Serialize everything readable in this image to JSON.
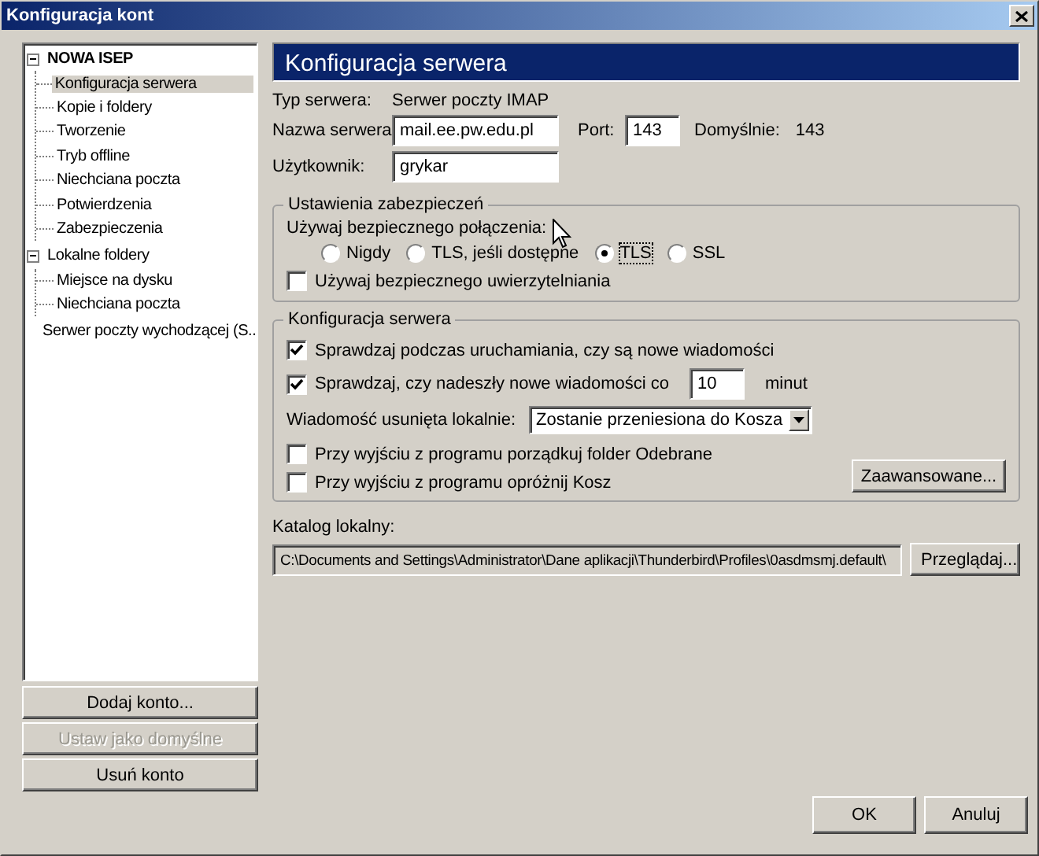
{
  "window": {
    "title": "Konfiguracja kont"
  },
  "tree": [
    {
      "label": "NOWA ISEP",
      "expanded": true,
      "selected": false,
      "children": [
        {
          "label": "Konfiguracja serwera",
          "selected": true
        },
        {
          "label": "Kopie i foldery",
          "selected": false
        },
        {
          "label": "Tworzenie",
          "selected": false
        },
        {
          "label": "Tryb offline",
          "selected": false
        },
        {
          "label": "Niechciana poczta",
          "selected": false
        },
        {
          "label": "Potwierdzenia",
          "selected": false
        },
        {
          "label": "Zabezpieczenia",
          "selected": false
        }
      ]
    },
    {
      "label": "Lokalne foldery",
      "expanded": true,
      "selected": false,
      "children": [
        {
          "label": "Miejsce na dysku",
          "selected": false
        },
        {
          "label": "Niechciana poczta",
          "selected": false
        }
      ]
    },
    {
      "label": "Serwer poczty wychodzącej (S...",
      "selected": false
    }
  ],
  "account_buttons": [
    {
      "label": "Dodaj konto...",
      "disabled": false
    },
    {
      "label": "Ustaw jako domyślne",
      "disabled": true
    },
    {
      "label": "Usuń konto",
      "disabled": false
    }
  ],
  "panel": {
    "title": "Konfiguracja serwera",
    "server_type": {
      "label": "Typ serwera:",
      "value": "Serwer poczty IMAP"
    },
    "server_name": {
      "label": "Nazwa serwera:",
      "value": "mail.ee.pw.edu.pl"
    },
    "port": {
      "label": "Port:",
      "value": "143"
    },
    "default_port": {
      "label": "Domyślnie:",
      "value": "143"
    },
    "user": {
      "label": "Użytkownik:",
      "value": "grykar"
    },
    "security": {
      "title": "Ustawienia zabezpieczeń",
      "connection_label": "Używaj bezpiecznego połączenia:",
      "options": [
        {
          "label": "Nigdy",
          "selected": false
        },
        {
          "label": "TLS, jeśli dostępne",
          "selected": false
        },
        {
          "label": "TLS",
          "selected": true
        },
        {
          "label": "SSL",
          "selected": false
        }
      ],
      "secure_auth": {
        "label": "Używaj bezpiecznego uwierzytelniania",
        "checked": false
      }
    },
    "server_settings": {
      "title": "Konfiguracja serwera",
      "check_on_startup": {
        "label": "Sprawdzaj podczas uruchamiania, czy są nowe wiadomości",
        "checked": true
      },
      "check_every": {
        "label": "Sprawdzaj, czy nadeszły nowe wiadomości co",
        "checked": true,
        "value": "10",
        "unit": "minut"
      },
      "deleted": {
        "label": "Wiadomość usunięta lokalnie:",
        "value": "Zostanie przeniesiona do Kosza"
      },
      "clean_inbox": {
        "label": "Przy wyjściu z programu porządkuj folder Odebrane",
        "checked": false
      },
      "empty_trash": {
        "label": "Przy wyjściu z programu opróżnij Kosz",
        "checked": false
      },
      "advanced_button": "Zaawansowane..."
    },
    "local_dir": {
      "label": "Katalog lokalny:",
      "value": "C:\\Documents and Settings\\Administrator\\Dane aplikacji\\Thunderbird\\Profiles\\0asdmsmj.default\\",
      "browse_button": "Przeglądaj..."
    }
  },
  "dialog_buttons": [
    "OK",
    "Anuluj"
  ]
}
